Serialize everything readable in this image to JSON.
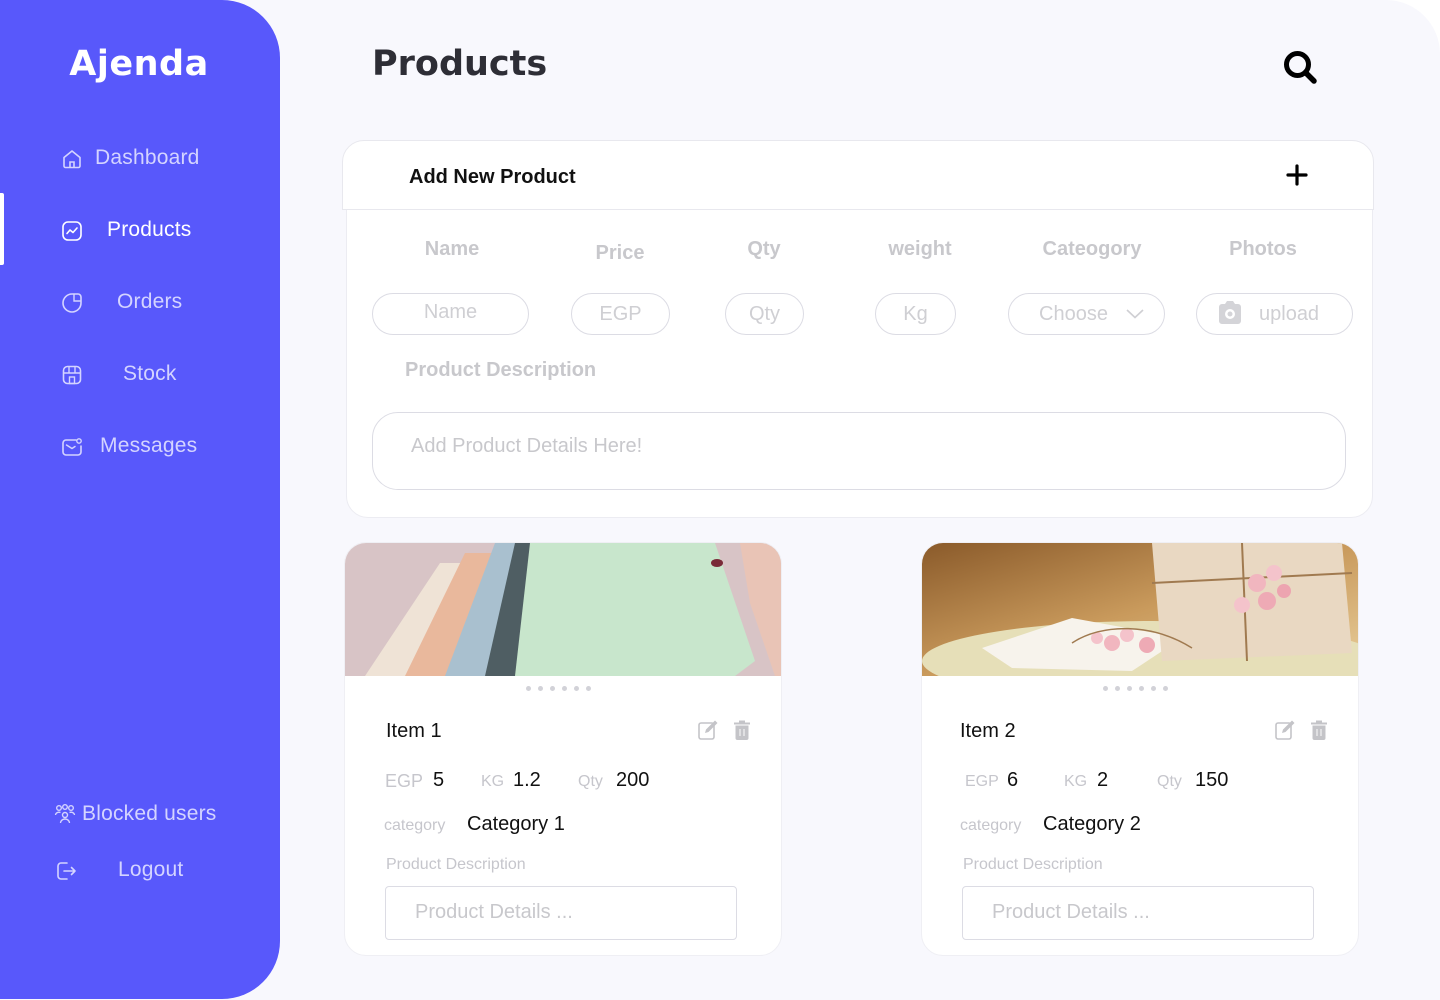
{
  "app": {
    "name": "Ajenda",
    "accent": "#5858fb"
  },
  "sidebar": {
    "items": [
      {
        "label": "Dashboard",
        "icon": "home-icon"
      },
      {
        "label": "Products",
        "icon": "chart-icon",
        "active": true
      },
      {
        "label": "Orders",
        "icon": "pie-icon"
      },
      {
        "label": "Stock",
        "icon": "store-icon"
      },
      {
        "label": "Messages",
        "icon": "mail-icon"
      }
    ],
    "bottom": [
      {
        "label": "Blocked users",
        "icon": "users-icon"
      },
      {
        "label": "Logout",
        "icon": "logout-icon"
      }
    ]
  },
  "header": {
    "title": "Products",
    "search_icon": "search-icon"
  },
  "add_product": {
    "title": "Add New Product",
    "plus_icon": "plus-icon",
    "labels": {
      "name": "Name",
      "price": "Price",
      "qty": "Qty",
      "weight": "weight",
      "category": "Cateogory",
      "photos": "Photos"
    },
    "placeholders": {
      "name": "Name",
      "price": "EGP",
      "qty": "Qty",
      "weight": "Kg",
      "category": "Choose",
      "photos": "upload"
    },
    "description_label": "Product Description",
    "description_placeholder": "Add Product Details Here!"
  },
  "products": [
    {
      "name": "Item 1",
      "price_unit": "EGP",
      "price": "5",
      "weight_unit": "KG",
      "weight": "1.2",
      "qty_label": "Qty",
      "qty": "200",
      "category_label": "category",
      "category": "Category 1",
      "description_label": "Product Description",
      "description_placeholder": "Product Details ..."
    },
    {
      "name": "Item 2",
      "price_unit": "EGP",
      "price": "6",
      "weight_unit": "KG",
      "weight": "2",
      "qty_label": "Qty",
      "qty": "150",
      "category_label": "category",
      "category": "Category 2",
      "description_label": "Product Description",
      "description_placeholder": "Product Details ..."
    }
  ]
}
